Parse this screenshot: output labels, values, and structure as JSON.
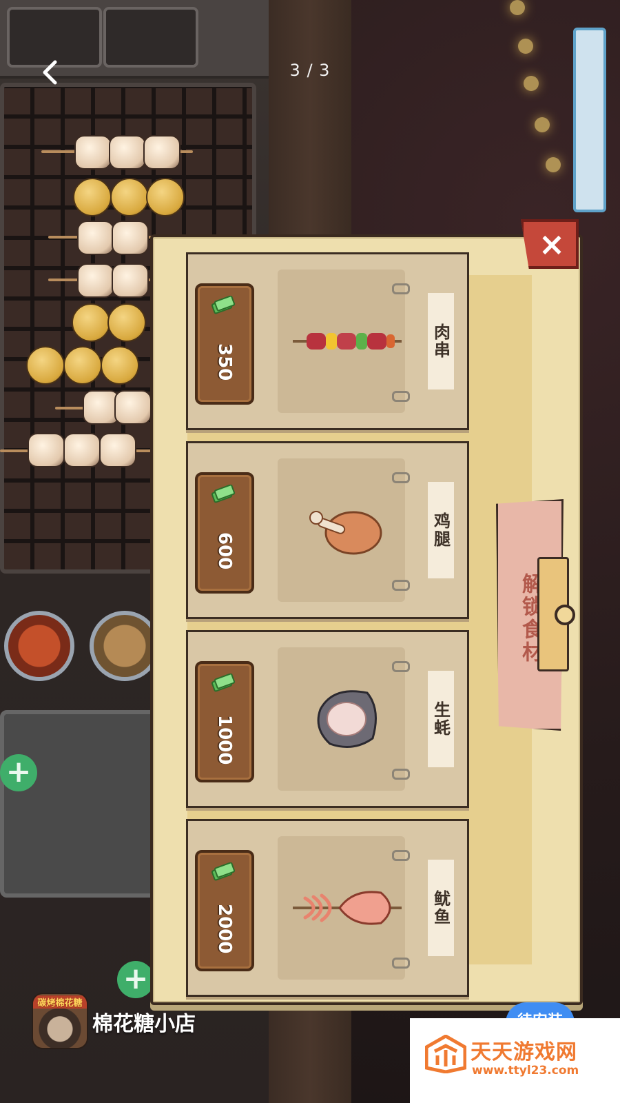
{
  "viewer": {
    "page_counter": "3 / 3"
  },
  "popup": {
    "close_label": "×",
    "unlock_label": "解锁食材",
    "items": [
      {
        "name": "肉串",
        "price": "350"
      },
      {
        "name": "鸡腿",
        "price": "600"
      },
      {
        "name": "生蚝",
        "price": "1000"
      },
      {
        "name": "鱿鱼",
        "price": "2000"
      }
    ]
  },
  "app_bar": {
    "icon_text": "碳烤棉花糖",
    "app_name": "棉花糖小店",
    "install_label": "待安装"
  },
  "watermark": {
    "name": "天天游戏网",
    "url": "www.ttyl23.com"
  },
  "colors": {
    "popup_paper": "#eedfae",
    "price_button": "#8d5a34",
    "close_button": "#c5483a",
    "unlock_banner": "#e8b7a8",
    "install_button": "#3f8df3",
    "watermark_orange": "#f07a31"
  }
}
